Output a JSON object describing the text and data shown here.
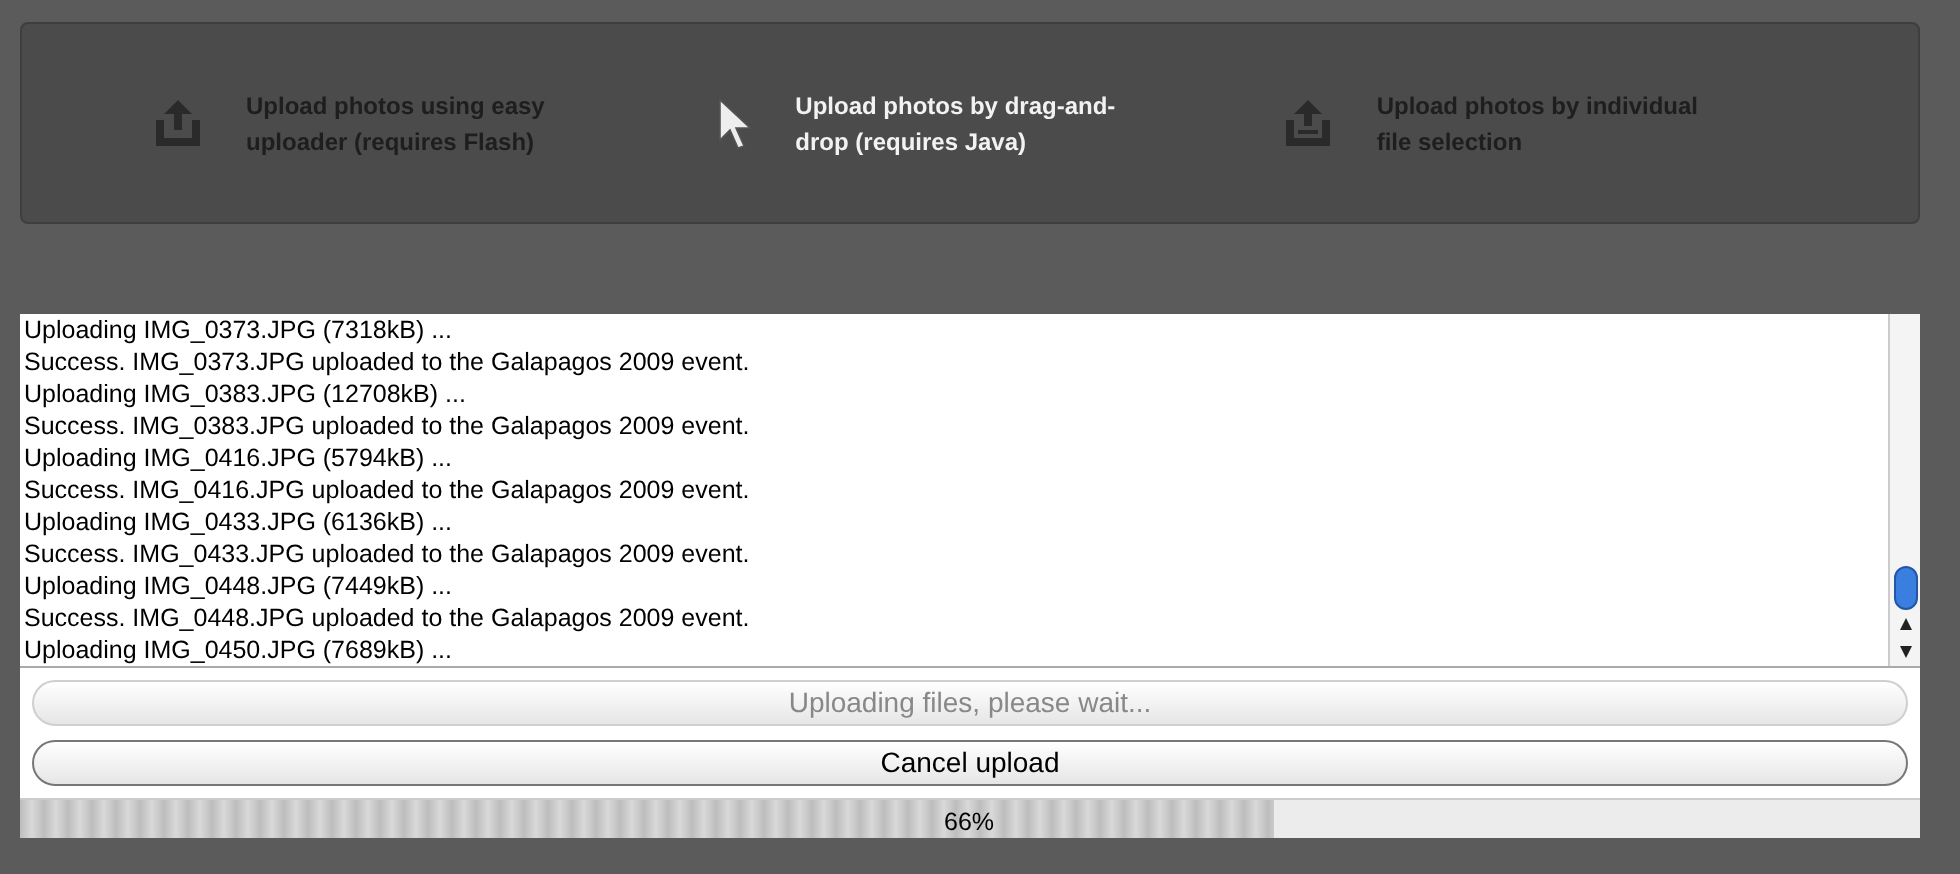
{
  "upload_options": [
    {
      "label": "Upload photos using easy uploader (requires Flash)",
      "kind": "upload",
      "selected": false
    },
    {
      "label": "Upload photos by drag-and-drop (requires Java)",
      "kind": "pointer",
      "selected": true
    },
    {
      "label": "Upload photos by individual file selection",
      "kind": "file",
      "selected": false
    }
  ],
  "log": [
    "Uploading IMG_0373.JPG (7318kB) ...",
    "Success. IMG_0373.JPG uploaded to the Galapagos 2009 event.",
    "Uploading IMG_0383.JPG (12708kB) ...",
    "Success. IMG_0383.JPG uploaded to the Galapagos 2009 event.",
    "Uploading IMG_0416.JPG (5794kB) ...",
    "Success. IMG_0416.JPG uploaded to the Galapagos 2009 event.",
    "Uploading IMG_0433.JPG (6136kB) ...",
    "Success. IMG_0433.JPG uploaded to the Galapagos 2009 event.",
    "Uploading IMG_0448.JPG (7449kB) ...",
    "Success. IMG_0448.JPG uploaded to the Galapagos 2009 event.",
    "Uploading IMG_0450.JPG (7689kB) ..."
  ],
  "buttons": [
    {
      "label": "Uploading files, please wait...",
      "disabled": true
    },
    {
      "label": "Cancel upload",
      "disabled": false
    }
  ],
  "progress": {
    "level": 0.66,
    "reading": "66%"
  }
}
